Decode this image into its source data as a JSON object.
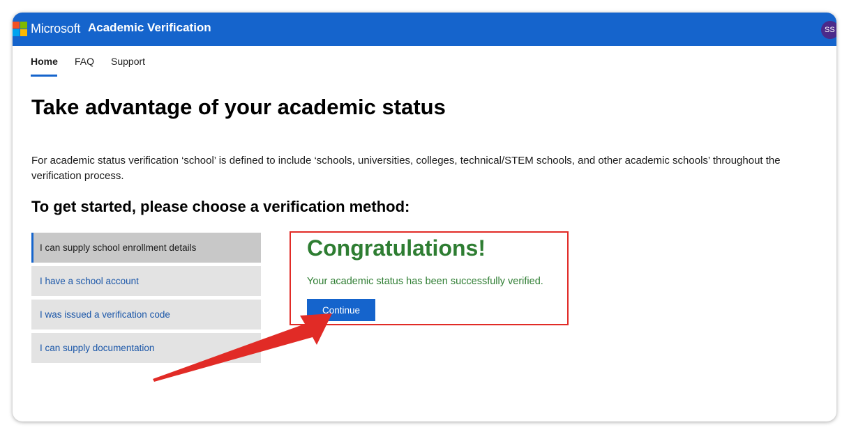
{
  "header": {
    "brand": "Microsoft",
    "app_title": "Academic Verification",
    "avatar_initials": "SS",
    "colors": {
      "bar": "#1564cc",
      "logo": [
        "#f25022",
        "#7fba00",
        "#00a4ef",
        "#ffb900"
      ]
    }
  },
  "nav": {
    "items": [
      {
        "label": "Home",
        "active": true
      },
      {
        "label": "FAQ",
        "active": false
      },
      {
        "label": "Support",
        "active": false
      }
    ]
  },
  "main": {
    "title": "Take advantage of your academic status",
    "intro": "For academic status verification ‘school’ is defined to include ‘schools, universities, colleges, technical/STEM schools, and other academic schools’ throughout the verification process.",
    "subheading": "To get started, please choose a verification method:",
    "methods": [
      {
        "label": "I can supply school enrollment details",
        "selected": true
      },
      {
        "label": "I have a school account",
        "selected": false
      },
      {
        "label": "I was issued a verification code",
        "selected": false
      },
      {
        "label": "I can supply documentation",
        "selected": false
      }
    ]
  },
  "result": {
    "title": "Congratulations!",
    "message": "Your academic status has been successfully verified.",
    "continue_label": "Continue",
    "colors": {
      "success": "#2e7d32",
      "highlight_border": "#e12b26"
    }
  },
  "annotation": {
    "icon": "red-arrow-icon",
    "color": "#e12b26"
  }
}
